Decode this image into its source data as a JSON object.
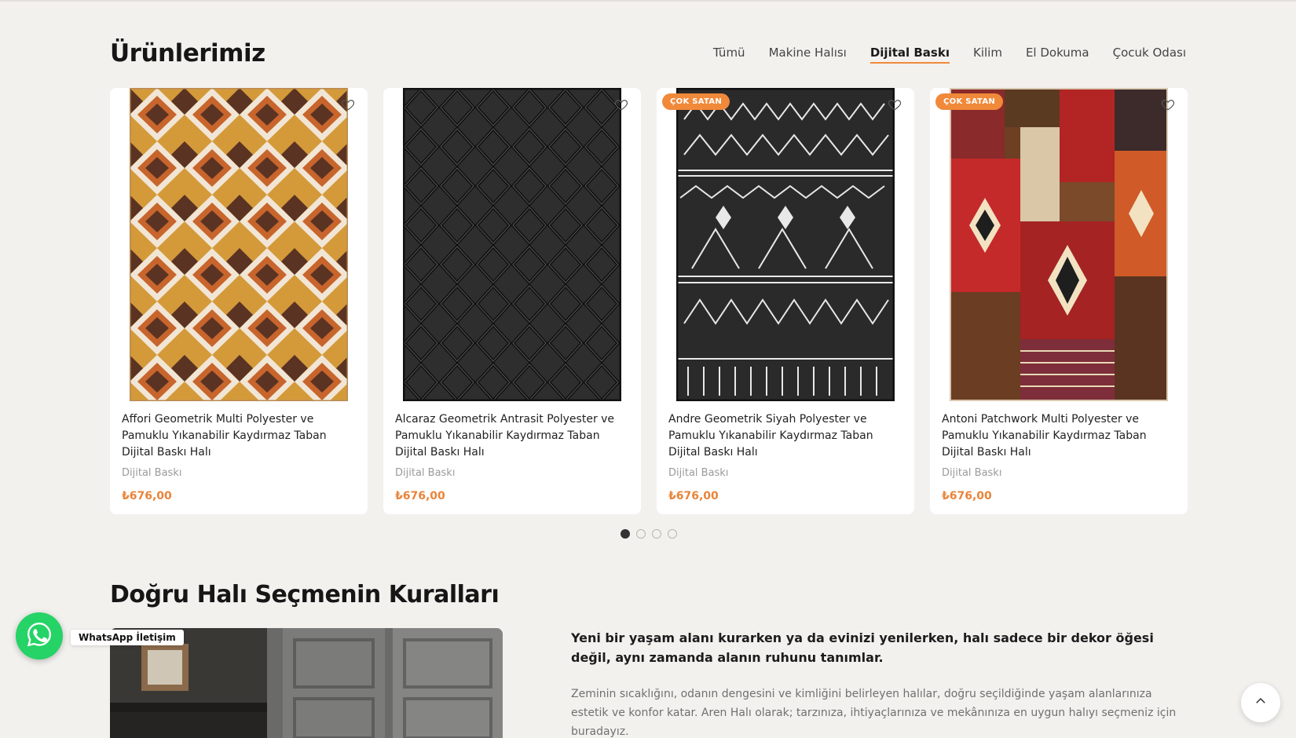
{
  "products_section": {
    "title": "Ürünlerimiz",
    "tabs": [
      {
        "label": "Tümü",
        "active": false
      },
      {
        "label": "Makine Halısı",
        "active": false
      },
      {
        "label": "Dijital Baskı",
        "active": true
      },
      {
        "label": "Kilim",
        "active": false
      },
      {
        "label": "El Dokuma",
        "active": false
      },
      {
        "label": "Çocuk Odası",
        "active": false
      }
    ],
    "products": [
      {
        "title": "Affori Geometrik Multi Polyester ve Pamuklu Yıkanabilir Kaydırmaz Taban Dijital Baskı Halı",
        "category": "Dijital Baskı",
        "price": "₺676,00",
        "badge": ""
      },
      {
        "title": "Alcaraz Geometrik Antrasit Polyester ve Pamuklu Yıkanabilir Kaydırmaz Taban Dijital Baskı Halı",
        "category": "Dijital Baskı",
        "price": "₺676,00",
        "badge": ""
      },
      {
        "title": "Andre Geometrik Siyah Polyester ve Pamuklu Yıkanabilir Kaydırmaz Taban Dijital Baskı Halı",
        "category": "Dijital Baskı",
        "price": "₺676,00",
        "badge": "ÇOK SATAN"
      },
      {
        "title": "Antoni Patchwork Multi Polyester ve Pamuklu Yıkanabilir Kaydırmaz Taban Dijital Baskı Halı",
        "category": "Dijital Baskı",
        "price": "₺676,00",
        "badge": "ÇOK SATAN"
      }
    ],
    "pagination": {
      "pages": 4,
      "active": 1
    }
  },
  "guide_section": {
    "title": "Doğru Halı Seçmenin Kuralları",
    "lead": "Yeni bir yaşam alanı kurarken ya da evinizi yenilerken, halı sadece bir dekor öğesi değil, aynı zamanda alanın ruhunu tanımlar.",
    "paragraph": "Zeminin sıcaklığını, odanın dengesini ve kimliğini belirleyen halılar, doğru seçildiğinde yaşam alanlarınıza estetik ve konfor katar. Aren Halı olarak; tarzınıza, ihtiyaçlarınıza ve mekânınıza en uygun halıyı seçmeniz için buradayız."
  },
  "whatsapp": {
    "label": "WhatsApp İletişim",
    "icon": "whatsapp-icon"
  },
  "scroll_top": {
    "icon": "chevron-up-icon"
  },
  "colors": {
    "accent": "#f08a3c",
    "price": "#e8843a",
    "whatsapp": "#25d366",
    "background": "#f3f1ee"
  }
}
